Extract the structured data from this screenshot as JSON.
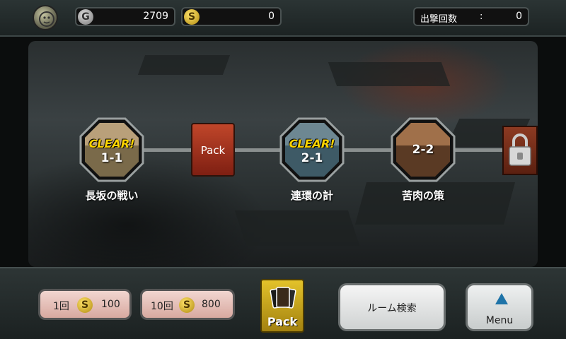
{
  "header": {
    "emblem_icon": "lion-emblem-icon",
    "gold": {
      "icon": "gold-coin-icon",
      "symbol": "G",
      "value": "2709"
    },
    "silver": {
      "icon": "silver-coin-icon",
      "symbol": "S",
      "value": "0"
    },
    "sortie": {
      "label": "出撃回数",
      "colon": ":",
      "value": "0"
    }
  },
  "map": {
    "stages": [
      {
        "id": "1-1",
        "status": "CLEAR!",
        "title": "長坂の戦い"
      },
      {
        "id": "pack",
        "label": "Pack"
      },
      {
        "id": "2-1",
        "status": "CLEAR!",
        "title": "連環の計"
      },
      {
        "id": "2-2",
        "title": "苦肉の策"
      },
      {
        "id": "locked",
        "icon": "lock-icon"
      }
    ]
  },
  "footer": {
    "buy_1": {
      "count_label": "1回",
      "coin_symbol": "S",
      "price": "100"
    },
    "buy_10": {
      "count_label": "10回",
      "coin_symbol": "S",
      "price": "800"
    },
    "pack_label": "Pack",
    "room_search": "ルーム検索",
    "menu": "Menu"
  }
}
